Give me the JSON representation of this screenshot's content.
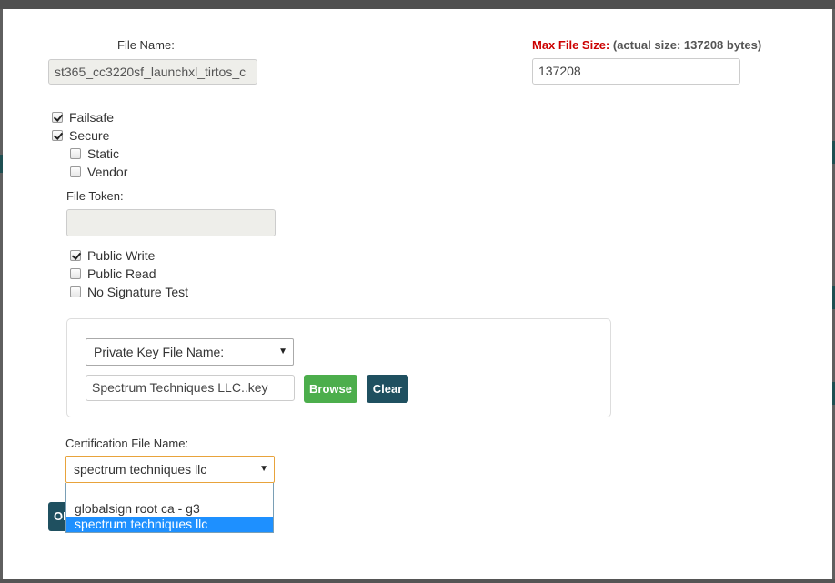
{
  "file_name": {
    "label": "File Name:",
    "value": "st365_cc3220sf_launchxl_tirtos_c"
  },
  "max_file_size": {
    "label": "Max File Size:",
    "actual": "(actual size: 137208 bytes)",
    "value": "137208",
    "label_color": "#cc0000"
  },
  "options": {
    "failsafe": {
      "label": "Failsafe",
      "checked": true
    },
    "secure": {
      "label": "Secure",
      "checked": true
    },
    "static": {
      "label": "Static",
      "checked": false
    },
    "vendor": {
      "label": "Vendor",
      "checked": false
    }
  },
  "file_token": {
    "label": "File Token:",
    "value": ""
  },
  "permissions": {
    "public_write": {
      "label": "Public Write",
      "checked": true
    },
    "public_read": {
      "label": "Public Read",
      "checked": false
    },
    "no_signature_test": {
      "label": "No Signature Test",
      "checked": false
    }
  },
  "private_key": {
    "select_value": "Private Key File Name:",
    "file_value": "Spectrum Techniques LLC..key",
    "browse_label": "Browse",
    "clear_label": "Clear"
  },
  "certification": {
    "label": "Certification File Name:",
    "selected": "spectrum techniques llc",
    "options": [
      "globalsign root ca - g3",
      "spectrum techniques llc"
    ]
  },
  "ok_button": {
    "label": "OK"
  },
  "colors": {
    "accent_green": "#4cae4c",
    "accent_teal": "#1f5060",
    "select_highlight": "#1e90ff"
  }
}
